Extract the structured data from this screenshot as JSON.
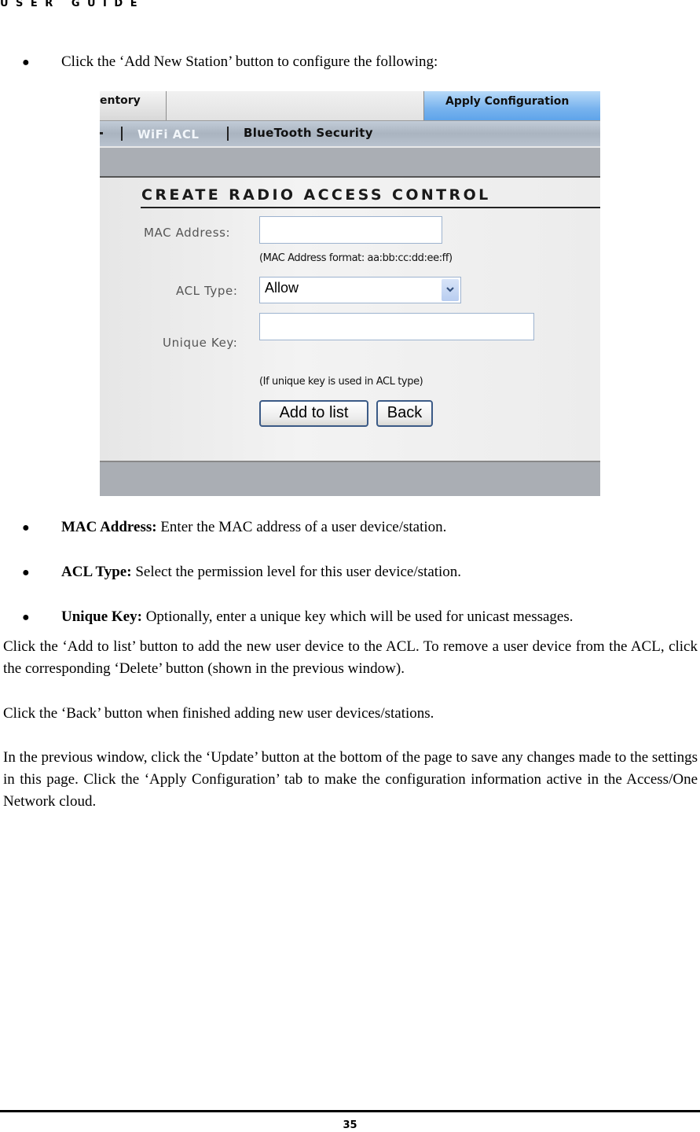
{
  "header": {
    "title": "USER GUIDE"
  },
  "intro_bullet": "Click the ‘Add New Station’ button to configure the following:",
  "screenshot": {
    "tabs": {
      "inventory_partial": "entory",
      "apply_configuration": "Apply Configuration"
    },
    "subnav": {
      "wifi_acl": "WiFi ACL",
      "bluetooth_security": "BlueTooth Security"
    },
    "form": {
      "title": "CREATE RADIO ACCESS CONTROL",
      "mac_address": {
        "label": "MAC Address:",
        "value": "",
        "hint": "(MAC Address format: aa:bb:cc:dd:ee:ff)"
      },
      "acl_type": {
        "label": "ACL Type:",
        "selected": "Allow"
      },
      "unique_key": {
        "label": "Unique Key:",
        "value": "",
        "hint": "(If unique key is used in ACL type)"
      },
      "buttons": {
        "add_to_list": "Add to list",
        "back": "Back"
      }
    },
    "colors": {
      "active_tab": "#78b3ee",
      "subnav": "#aab4c0",
      "bar": "#aaaeb4",
      "button_border": "#3b5a86"
    }
  },
  "field_bullets": [
    {
      "term": "MAC Address:",
      "text": " Enter the MAC address of a user device/station."
    },
    {
      "term": "ACL Type:",
      "text": " Select the permission level for this user device/station."
    },
    {
      "term": "Unique Key:",
      "text": " Optionally, enter a unique key which will be used for unicast messages."
    }
  ],
  "paragraphs": [
    "Click the ‘Add to list’ button to add the new user device to the ACL. To remove a user device from the ACL, click the corresponding ‘Delete’ button (shown in the previous window).",
    "Click the ‘Back’ button when finished adding new user devices/stations.",
    "In the previous window, click the ‘Update’ button at the bottom of the page to save any changes made to the settings in this page. Click the ‘Apply Configuration’ tab to make the configuration information active in the Access/One Network cloud."
  ],
  "footer": {
    "page_number": "35"
  }
}
